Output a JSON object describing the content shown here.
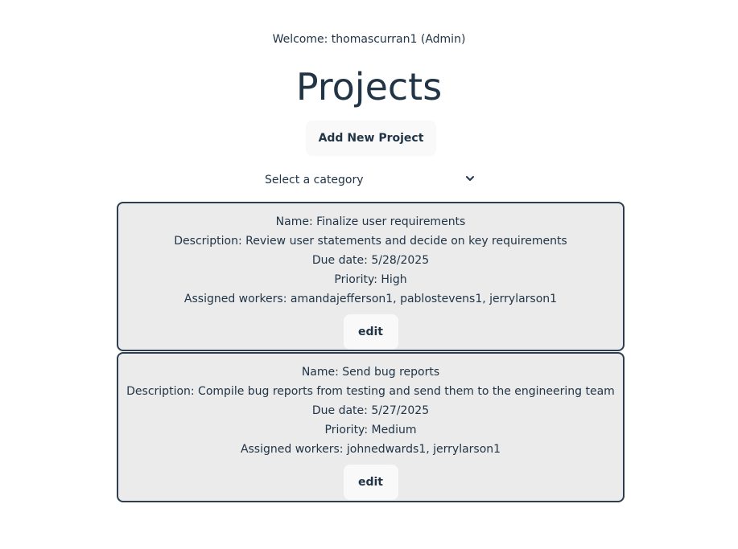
{
  "header": {
    "welcome": "Welcome: thomascurran1 (Admin)",
    "title": "Projects"
  },
  "toolbar": {
    "add_label": "Add New Project"
  },
  "category_select": {
    "selected": "Select a category"
  },
  "projects": [
    {
      "name": "Name: Finalize user requirements",
      "description": "Description: Review user statements and decide on key requirements",
      "due": "Due date: 5/28/2025",
      "priority": "Priority: High",
      "workers": "Assigned workers: amandajefferson1, pablostevens1, jerrylarson1",
      "edit_label": "edit"
    },
    {
      "name": "Name: Send bug reports",
      "description": "Description: Compile bug reports from testing and send them to the engineering team",
      "due": "Due date: 5/27/2025",
      "priority": "Priority: Medium",
      "workers": "Assigned workers: johnedwards1, jerrylarson1",
      "edit_label": "edit"
    }
  ],
  "colors": {
    "text": "#213547",
    "card_background": "#ebebeb",
    "card_border": "#2c3e50",
    "button_background": "#f9f9f9"
  },
  "icons": {
    "select": "chevron-down-icon"
  }
}
